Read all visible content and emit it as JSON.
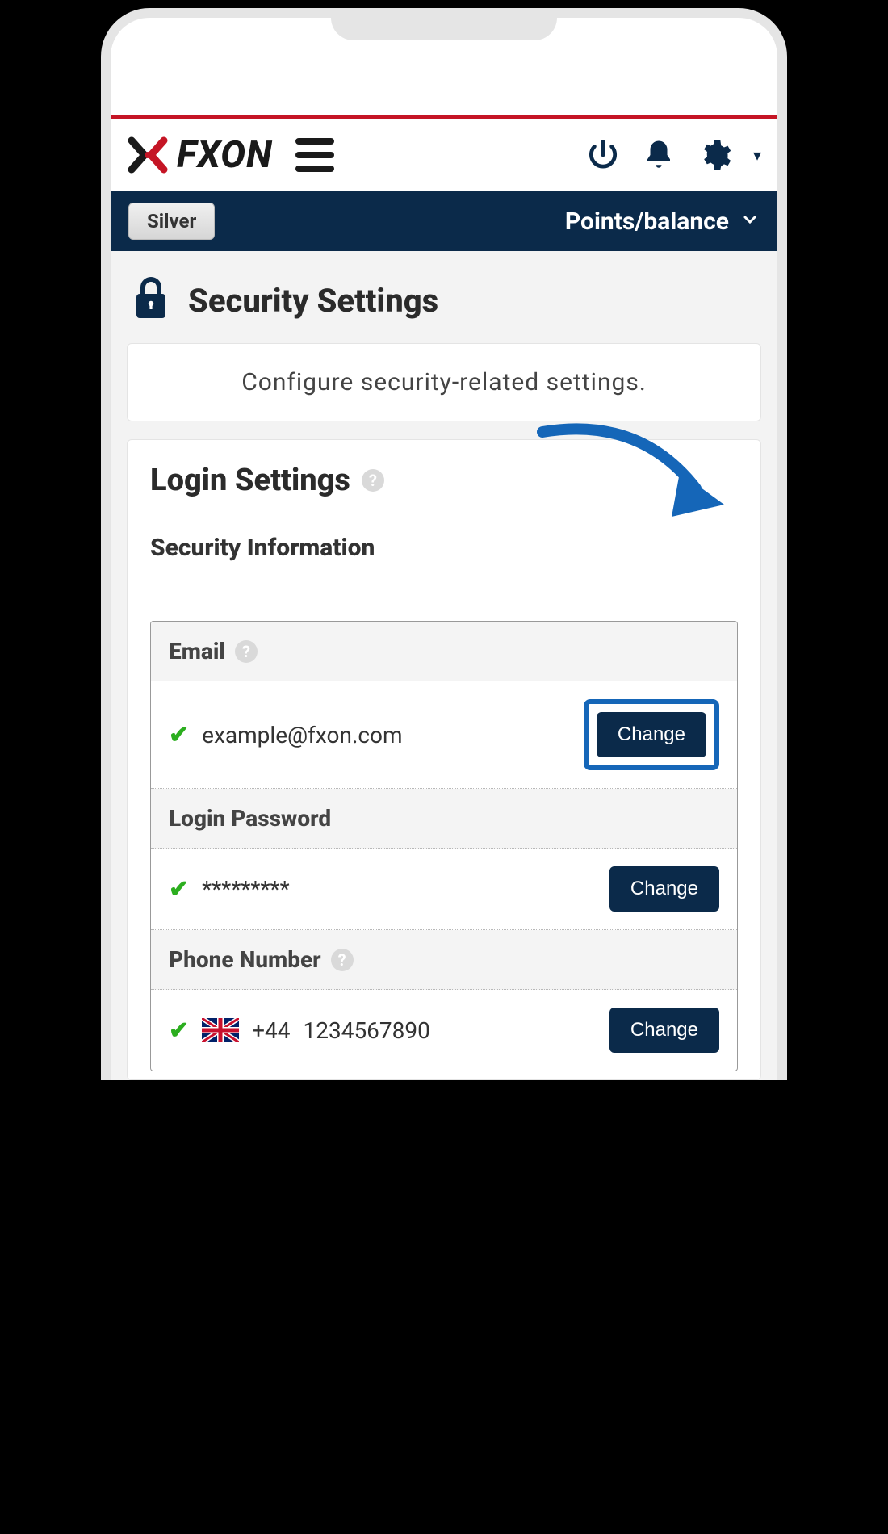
{
  "brand": {
    "name": "FXON"
  },
  "status_bar": {
    "tier_label": "Silver",
    "points_label": "Points/balance"
  },
  "page": {
    "title": "Security Settings",
    "intro": "Configure security-related settings."
  },
  "login_section": {
    "title": "Login Settings",
    "sub_heading": "Security Information",
    "rows": {
      "email": {
        "label": "Email",
        "value": "example@fxon.com",
        "button": "Change"
      },
      "password": {
        "label": "Login Password",
        "value": "*********",
        "button": "Change"
      },
      "phone": {
        "label": "Phone Number",
        "code": "+44",
        "number": "1234567890",
        "button": "Change"
      }
    }
  }
}
